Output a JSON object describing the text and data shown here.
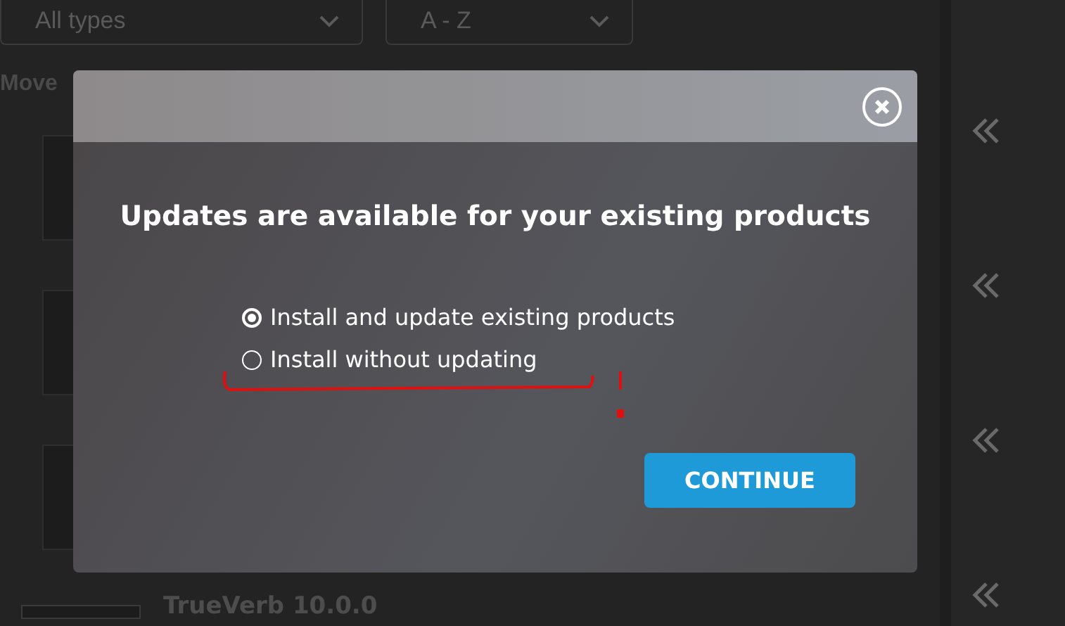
{
  "filters": [
    {
      "value": "All types"
    },
    {
      "value": "A - Z"
    }
  ],
  "move_all": "Move",
  "products": [
    {
      "name": "TrueVerb 10.0.0"
    }
  ],
  "dialog": {
    "title": "Updates are available for your existing products",
    "options": [
      {
        "label": "Install and update existing products",
        "selected": true
      },
      {
        "label": "Install without updating",
        "selected": false
      }
    ],
    "button": "CONTINUE"
  }
}
